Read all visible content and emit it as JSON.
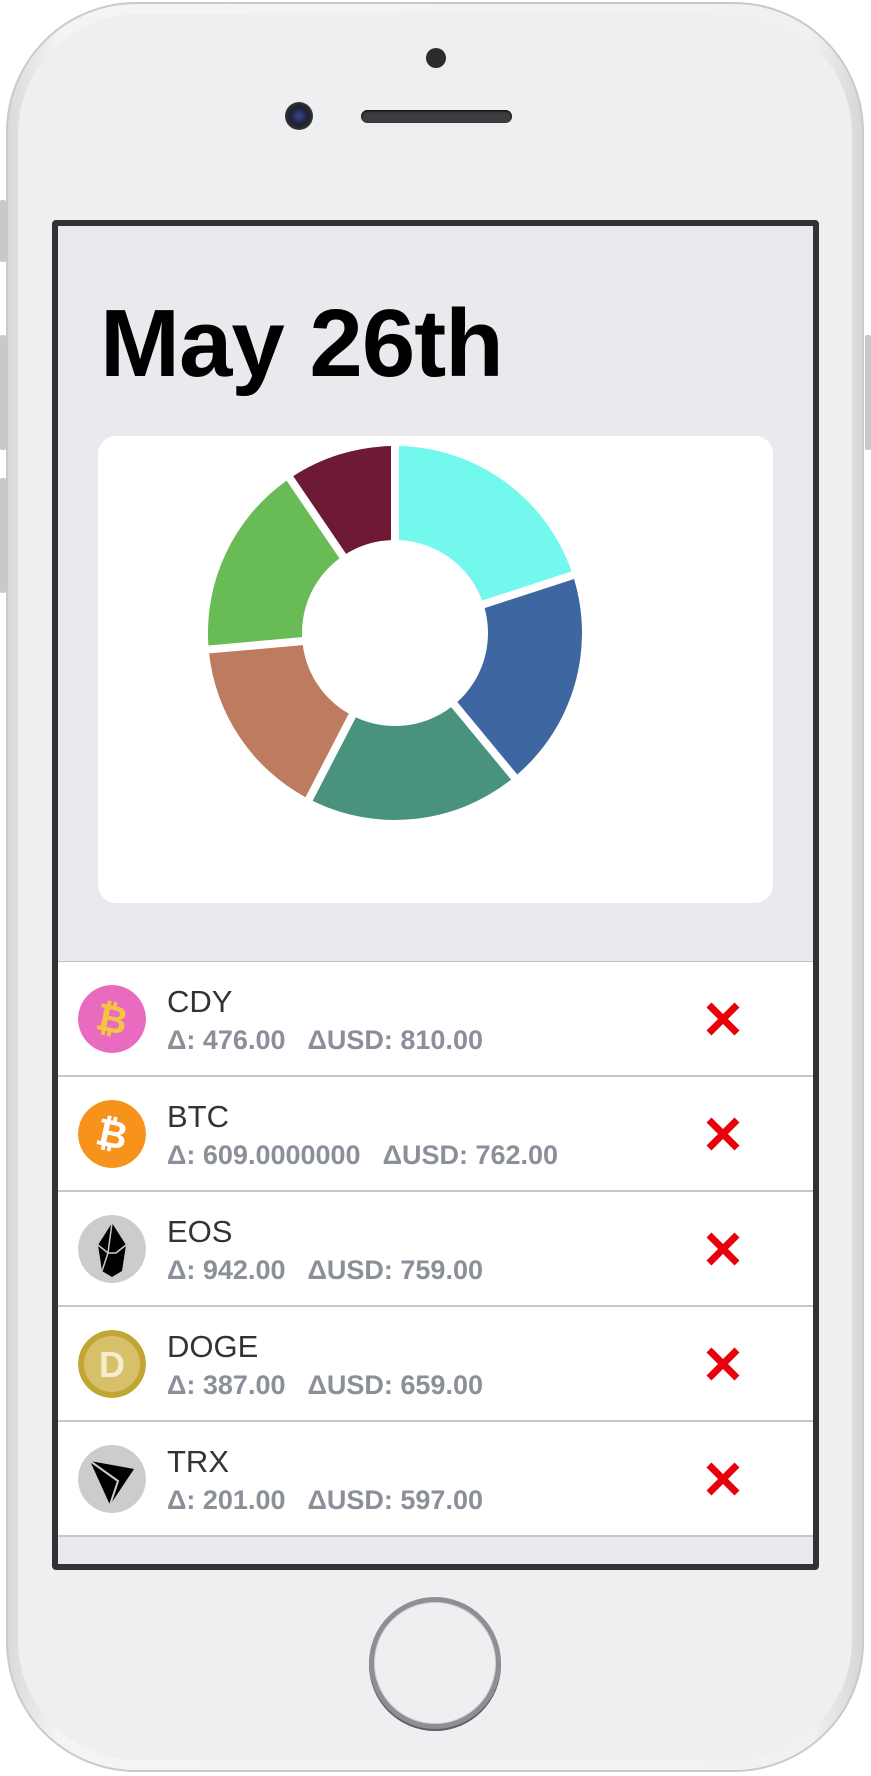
{
  "screen": {
    "title": "May 26th"
  },
  "colors": {
    "background": "#e9e9ee",
    "card": "#ffffff",
    "remove": "#e8000b",
    "muted_text": "#8b8f99",
    "primary_text": "#333333"
  },
  "chart_data": {
    "type": "pie",
    "style": "donut",
    "title": "",
    "legend": "none",
    "segments": [
      {
        "value": 20.0,
        "color": "#73f8ed"
      },
      {
        "value": 19.0,
        "color": "#3e66a1"
      },
      {
        "value": 18.6,
        "color": "#49927d"
      },
      {
        "value": 16.0,
        "color": "#bd7b5f"
      },
      {
        "value": 16.9,
        "color": "#68bb55"
      },
      {
        "value": 9.5,
        "color": "#6e1a37"
      }
    ]
  },
  "holdings": [
    {
      "symbol": "CDY",
      "delta": "Δ: 476.00",
      "usd": "ΔUSD: 810.00",
      "icon": "bitcoin-candy-icon"
    },
    {
      "symbol": "BTC",
      "delta": "Δ: 609.0000000",
      "usd": "ΔUSD: 762.00",
      "icon": "bitcoin-icon"
    },
    {
      "symbol": "EOS",
      "delta": "Δ: 942.00",
      "usd": "ΔUSD: 759.00",
      "icon": "eos-icon"
    },
    {
      "symbol": "DOGE",
      "delta": "Δ: 387.00",
      "usd": "ΔUSD: 659.00",
      "icon": "dogecoin-icon"
    },
    {
      "symbol": "TRX",
      "delta": "Δ: 201.00",
      "usd": "ΔUSD: 597.00",
      "icon": "tron-icon"
    }
  ]
}
